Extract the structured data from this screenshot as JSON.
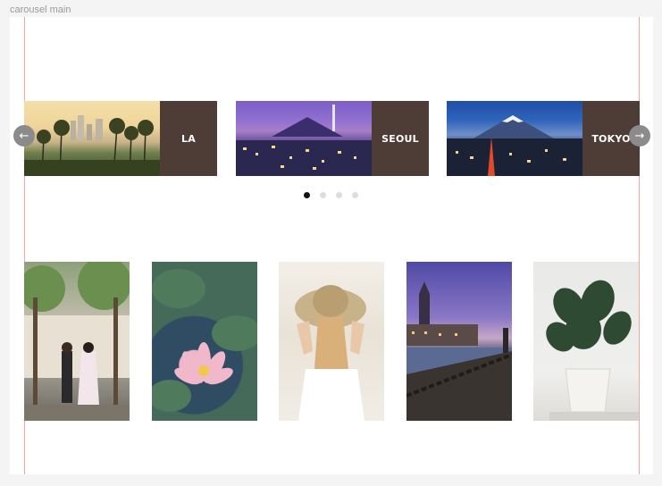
{
  "frame": {
    "label": "carousel main"
  },
  "carousel": {
    "cards": [
      {
        "label": "LA"
      },
      {
        "label": "SEOUL"
      },
      {
        "label": "TOKYO"
      }
    ],
    "prev_icon": "arrow-left-icon",
    "next_icon": "arrow-right-icon",
    "dots_count": 4,
    "active_dot": 1
  },
  "gallery": {
    "tiles": [
      "couple-under-trees-photo",
      "pink-water-lily-photo",
      "woman-straw-hat-photo",
      "city-waterfront-dusk-photo",
      "potted-monstera-plant-photo"
    ]
  },
  "colors": {
    "tag_background": "#4e3c37",
    "guide_line": "#e9a9a1",
    "arrow_background": "#8b8b8b",
    "dot_active": "#111111",
    "dot_inactive": "#dddddd"
  }
}
